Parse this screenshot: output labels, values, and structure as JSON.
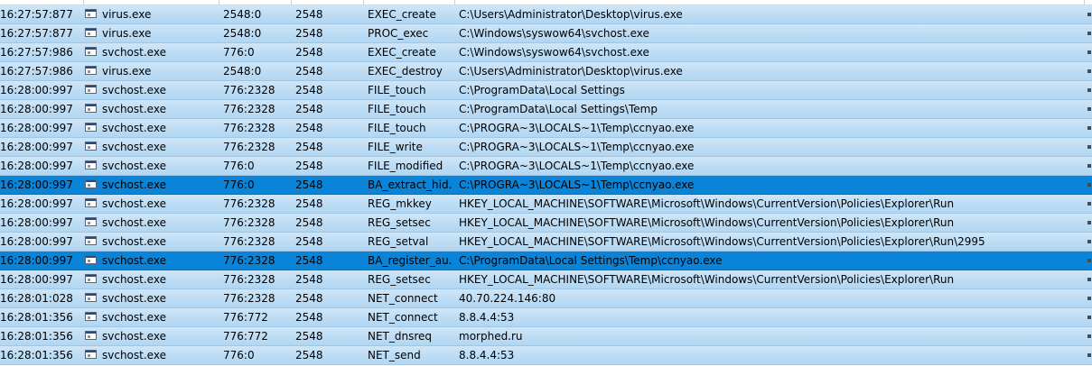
{
  "rows": [
    {
      "time": "16:27:57:877",
      "process": "virus.exe",
      "pid": "2548:0",
      "ppid": "2548",
      "action": "EXEC_create",
      "path": "C:\\Users\\Administrator\\Desktop\\virus.exe",
      "selected": false
    },
    {
      "time": "16:27:57:877",
      "process": "virus.exe",
      "pid": "2548:0",
      "ppid": "2548",
      "action": "PROC_exec",
      "path": "C:\\Windows\\syswow64\\svchost.exe",
      "selected": false
    },
    {
      "time": "16:27:57:986",
      "process": "svchost.exe",
      "pid": "776:0",
      "ppid": "2548",
      "action": "EXEC_create",
      "path": "C:\\Windows\\syswow64\\svchost.exe",
      "selected": false
    },
    {
      "time": "16:27:57:986",
      "process": "virus.exe",
      "pid": "2548:0",
      "ppid": "2548",
      "action": "EXEC_destroy",
      "path": "C:\\Users\\Administrator\\Desktop\\virus.exe",
      "selected": false
    },
    {
      "time": "16:28:00:997",
      "process": "svchost.exe",
      "pid": "776:2328",
      "ppid": "2548",
      "action": "FILE_touch",
      "path": "C:\\ProgramData\\Local Settings",
      "selected": false
    },
    {
      "time": "16:28:00:997",
      "process": "svchost.exe",
      "pid": "776:2328",
      "ppid": "2548",
      "action": "FILE_touch",
      "path": "C:\\ProgramData\\Local Settings\\Temp",
      "selected": false
    },
    {
      "time": "16:28:00:997",
      "process": "svchost.exe",
      "pid": "776:2328",
      "ppid": "2548",
      "action": "FILE_touch",
      "path": "C:\\PROGRA~3\\LOCALS~1\\Temp\\ccnyao.exe",
      "selected": false
    },
    {
      "time": "16:28:00:997",
      "process": "svchost.exe",
      "pid": "776:2328",
      "ppid": "2548",
      "action": "FILE_write",
      "path": "C:\\PROGRA~3\\LOCALS~1\\Temp\\ccnyao.exe",
      "selected": false
    },
    {
      "time": "16:28:00:997",
      "process": "svchost.exe",
      "pid": "776:0",
      "ppid": "2548",
      "action": "FILE_modified",
      "path": "C:\\PROGRA~3\\LOCALS~1\\Temp\\ccnyao.exe",
      "selected": false
    },
    {
      "time": "16:28:00:997",
      "process": "svchost.exe",
      "pid": "776:0",
      "ppid": "2548",
      "action": "BA_extract_hid...",
      "path": "C:\\PROGRA~3\\LOCALS~1\\Temp\\ccnyao.exe",
      "selected": true
    },
    {
      "time": "16:28:00:997",
      "process": "svchost.exe",
      "pid": "776:2328",
      "ppid": "2548",
      "action": "REG_mkkey",
      "path": "HKEY_LOCAL_MACHINE\\SOFTWARE\\Microsoft\\Windows\\CurrentVersion\\Policies\\Explorer\\Run",
      "selected": false
    },
    {
      "time": "16:28:00:997",
      "process": "svchost.exe",
      "pid": "776:2328",
      "ppid": "2548",
      "action": "REG_setsec",
      "path": "HKEY_LOCAL_MACHINE\\SOFTWARE\\Microsoft\\Windows\\CurrentVersion\\Policies\\Explorer\\Run",
      "selected": false
    },
    {
      "time": "16:28:00:997",
      "process": "svchost.exe",
      "pid": "776:2328",
      "ppid": "2548",
      "action": "REG_setval",
      "path": "HKEY_LOCAL_MACHINE\\SOFTWARE\\Microsoft\\Windows\\CurrentVersion\\Policies\\Explorer\\Run\\2995",
      "selected": false
    },
    {
      "time": "16:28:00:997",
      "process": "svchost.exe",
      "pid": "776:2328",
      "ppid": "2548",
      "action": "BA_register_au...",
      "path": "C:\\ProgramData\\Local Settings\\Temp\\ccnyao.exe",
      "selected": true
    },
    {
      "time": "16:28:00:997",
      "process": "svchost.exe",
      "pid": "776:2328",
      "ppid": "2548",
      "action": "REG_setsec",
      "path": "HKEY_LOCAL_MACHINE\\SOFTWARE\\Microsoft\\Windows\\CurrentVersion\\Policies\\Explorer\\Run",
      "selected": false
    },
    {
      "time": "16:28:01:028",
      "process": "svchost.exe",
      "pid": "776:2328",
      "ppid": "2548",
      "action": "NET_connect",
      "path": "40.70.224.146:80",
      "selected": false
    },
    {
      "time": "16:28:01:356",
      "process": "svchost.exe",
      "pid": "776:772",
      "ppid": "2548",
      "action": "NET_connect",
      "path": "8.8.4.4:53",
      "selected": false
    },
    {
      "time": "16:28:01:356",
      "process": "svchost.exe",
      "pid": "776:772",
      "ppid": "2548",
      "action": "NET_dnsreq",
      "path": "morphed.ru",
      "selected": false
    },
    {
      "time": "16:28:01:356",
      "process": "svchost.exe",
      "pid": "776:0",
      "ppid": "2548",
      "action": "NET_send",
      "path": "8.8.4.4:53",
      "selected": false
    }
  ],
  "icons": {
    "process": "window-app-icon",
    "tail": "overflow-marker-icon"
  },
  "colors": {
    "row": "#bcdcf4",
    "row_selected": "#0a84d8",
    "row_border": "#9ec7ea"
  }
}
